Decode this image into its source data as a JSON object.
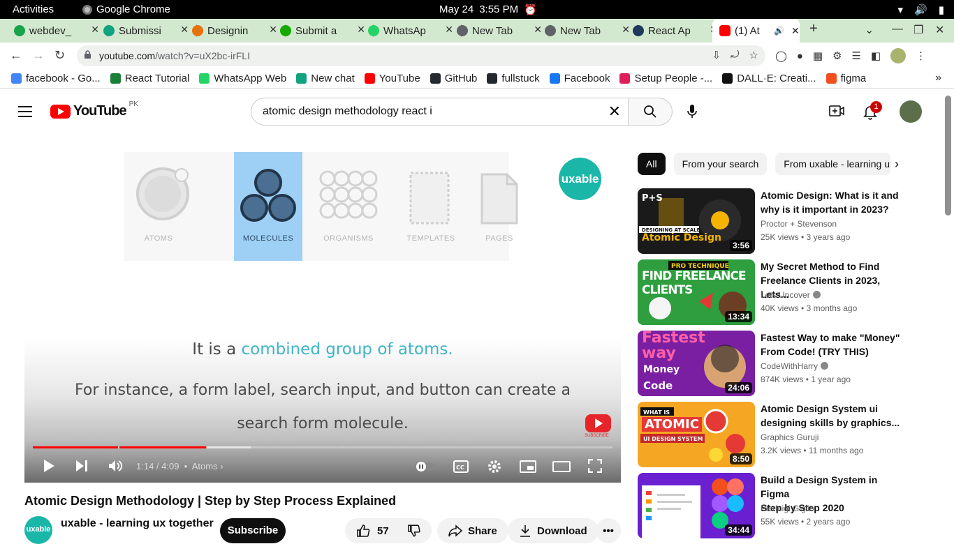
{
  "system_bar": {
    "activities": "Activities",
    "app_name": "Google Chrome",
    "date": "May 24",
    "time": "3:55 PM"
  },
  "tabs": [
    {
      "title": "webdev_",
      "color": "#16a34a"
    },
    {
      "title": "Submissi",
      "color": "#10a37f"
    },
    {
      "title": "Designin",
      "color": "#e8710a"
    },
    {
      "title": "Submit a",
      "color": "#14a800"
    },
    {
      "title": "WhatsAp",
      "color": "#25d366"
    },
    {
      "title": "New Tab",
      "color": "#5f6368"
    },
    {
      "title": "New Tab",
      "color": "#5f6368"
    },
    {
      "title": "React Ap",
      "color": "#1e3a5f"
    }
  ],
  "active_tab": {
    "title": "(1) At",
    "color": "#ff0000"
  },
  "address_bar": {
    "host": "youtube.com",
    "path": "/watch?v=uX2bc-irFLI"
  },
  "bookmarks": [
    {
      "label": "facebook - Go...",
      "color": "#4285f4"
    },
    {
      "label": "React Tutorial",
      "color": "#1a7f37"
    },
    {
      "label": "WhatsApp Web",
      "color": "#25d366"
    },
    {
      "label": "New chat",
      "color": "#10a37f"
    },
    {
      "label": "YouTube",
      "color": "#ff0000"
    },
    {
      "label": "GitHub",
      "color": "#24292f"
    },
    {
      "label": "fullstuck",
      "color": "#24292f"
    },
    {
      "label": "Facebook",
      "color": "#1877f2"
    },
    {
      "label": "Setup People -...",
      "color": "#e01e5a"
    },
    {
      "label": "DALL·E: Creati...",
      "color": "#111111"
    },
    {
      "label": "figma",
      "color": "#f24e1e"
    }
  ],
  "youtube": {
    "logo_text": "YouTube",
    "country_code": "PK",
    "search_query": "atomic design methodology react i",
    "notification_count": "1"
  },
  "player": {
    "atom_cards": [
      {
        "label": "ATOMS"
      },
      {
        "label": "MOLECULES"
      },
      {
        "label": "ORGANISMS"
      },
      {
        "label": "TEMPLATES"
      },
      {
        "label": "PAGES"
      }
    ],
    "badge": "uxable",
    "caption_line1_pre": "It is a ",
    "caption_line1_highlight": "combined group of atoms.",
    "caption_line2": "For instance, a form label, search input, and button can create a",
    "caption_line3": "search form molecule.",
    "subscribe_watermark": "SUBSCRIBE",
    "timecode": "1:14 / 4:09",
    "chapter": "Atoms",
    "progress_fraction": 0.3,
    "accent": "#ff0000"
  },
  "video": {
    "title": "Atomic Design Methodology | Step by Step Process Explained",
    "channel": "uxable - learning ux together",
    "channel_avatar": "uxable",
    "subscribe": "Subscribe",
    "likes": "57",
    "share": "Share",
    "download": "Download"
  },
  "sidebar": {
    "chips": [
      "All",
      "From your search",
      "From uxable - learning ux together"
    ],
    "recommendations": [
      {
        "title_line1": "Atomic Design: What is it and",
        "title_line2": "why is it important in 2023?",
        "channel": "Proctor + Stevenson",
        "meta": "25K views  •  3 years ago",
        "duration": "3:56",
        "thumb_text": "Atomic Design",
        "thumb_bg": "#1a1a1a",
        "verified": false
      },
      {
        "title_line1": "My Secret Method to Find",
        "title_line2": "Freelance Clients in 2023, Lets...",
        "channel": "Lets Uncover",
        "meta": "40K views  •  3 months ago",
        "duration": "13:34",
        "thumb_text": "FIND FREELANCE CLIENTS",
        "thumb_bg": "#2e9e3e",
        "verified": true
      },
      {
        "title_line1": "Fastest Way to make \"Money\"",
        "title_line2": "From Code! (TRY THIS)",
        "channel": "CodeWithHarry",
        "meta": "874K views  •  1 year ago",
        "duration": "24:06",
        "thumb_text": "Fastest way",
        "thumb_bg": "#7b1fa2",
        "verified": true
      },
      {
        "title_line1": "Atomic Design System ui",
        "title_line2": "designing skills by graphics...",
        "channel": "Graphics Guruji",
        "meta": "3.2K views  •  11 months ago",
        "duration": "8:50",
        "thumb_text": "ATOMIC",
        "thumb_bg": "#f5a623",
        "verified": false
      },
      {
        "title_line1": "Build a Design System in Figma",
        "title_line2": "Step by Step 2020",
        "channel": "Pierluigi Giglio",
        "meta": "55K views  •  2 years ago",
        "duration": "34:44",
        "thumb_text": "",
        "thumb_bg": "#6a1fd1",
        "verified": false
      }
    ]
  }
}
